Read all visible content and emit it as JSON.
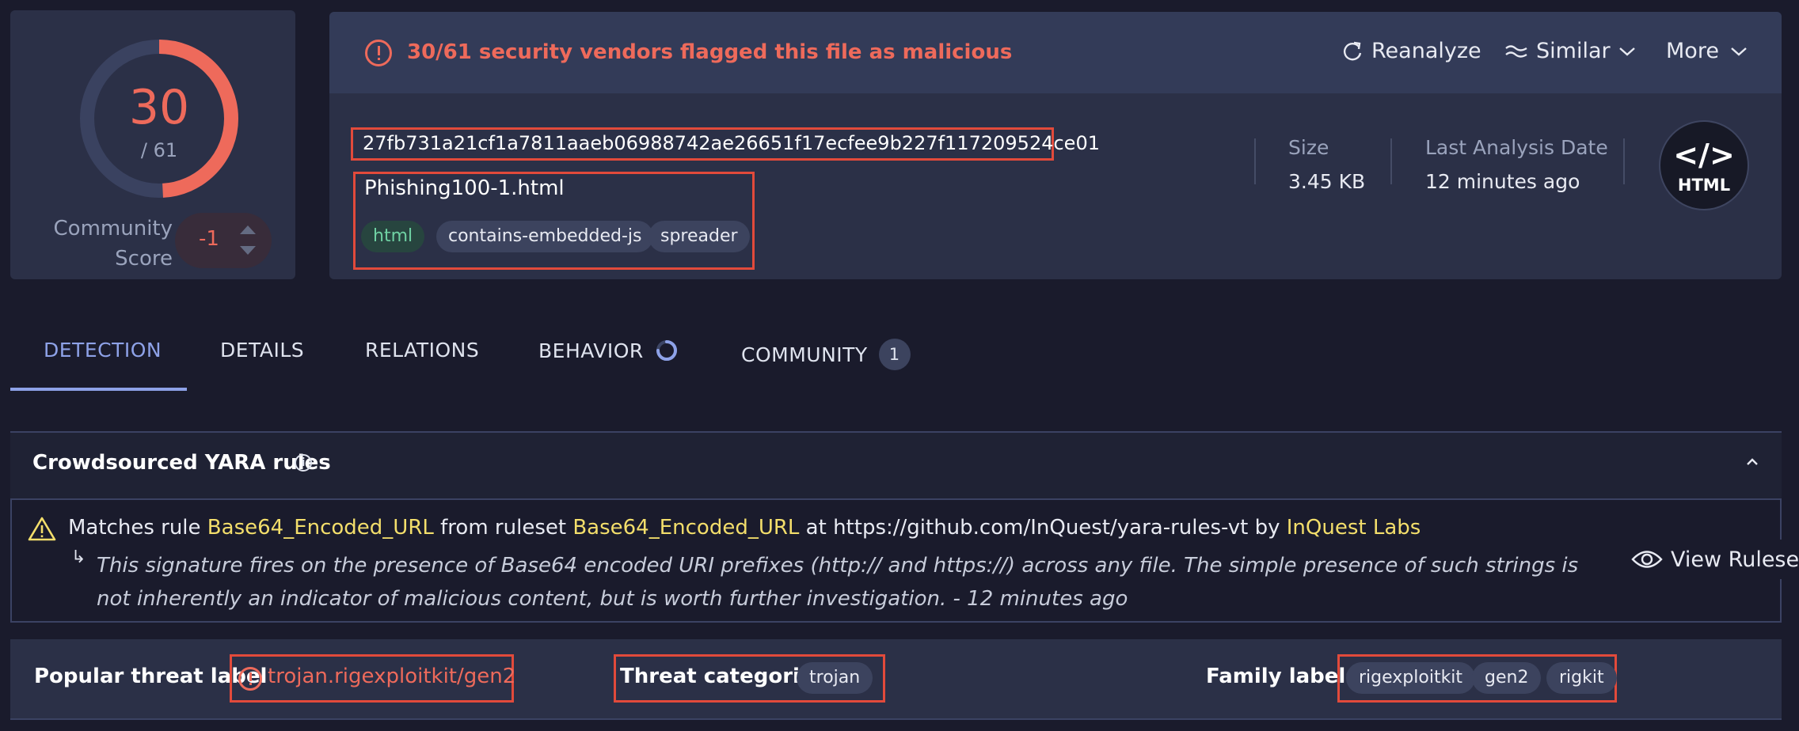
{
  "score": {
    "detections": "30",
    "total": "/ 61",
    "community_label_line1": "Community",
    "community_label_line2": "Score",
    "community_value": "-1"
  },
  "alert": {
    "text": "30/61 security vendors flagged this file as malicious"
  },
  "actions": {
    "reanalyze": "Reanalyze",
    "similar": "Similar",
    "more": "More"
  },
  "file": {
    "hash": "27fb731a21cf1a7811aaeb06988742ae26651f17ecfee9b227f117209524ce01",
    "name": "Phishing100-1.html",
    "tags": [
      "html",
      "contains-embedded-js",
      "spreader"
    ],
    "size_label": "Size",
    "size_value": "3.45 KB",
    "date_label": "Last Analysis Date",
    "date_value": "12 minutes ago",
    "type_code": "</>",
    "type_label": "HTML"
  },
  "tabs": [
    {
      "label": "DETECTION"
    },
    {
      "label": "DETAILS"
    },
    {
      "label": "RELATIONS"
    },
    {
      "label": "BEHAVIOR"
    },
    {
      "label": "COMMUNITY",
      "count": "1"
    }
  ],
  "yara": {
    "title": "Crowdsourced YARA rules",
    "match_prefix": "Matches rule ",
    "rule": "Base64_Encoded_URL",
    "from_text": " from ruleset ",
    "ruleset": "Base64_Encoded_URL",
    "at_text": " at https://github.com/InQuest/yara-rules-vt by ",
    "author": "InQuest Labs",
    "arrow": "↳",
    "description": "This signature fires on the presence of Base64 encoded URI prefixes (http:// and https://) across any file. The simple presence of such strings is not inherently an indicator of malicious content, but is worth further investigation. - 12 minutes ago",
    "view_ruleset": "View Ruleset"
  },
  "threat": {
    "popular_label": "Popular threat label",
    "popular_value": "trojan.rigexploitkit/gen2",
    "categories_label": "Threat categories",
    "categories": [
      "trojan"
    ],
    "families_label": "Family labels",
    "families": [
      "rigexploitkit",
      "gen2",
      "rigkit"
    ]
  },
  "colors": {
    "malicious": "#ee6a5b",
    "accent": "#8ea2e8",
    "highlight": "#f3de6b",
    "html_tag": "#6fd1a3"
  }
}
